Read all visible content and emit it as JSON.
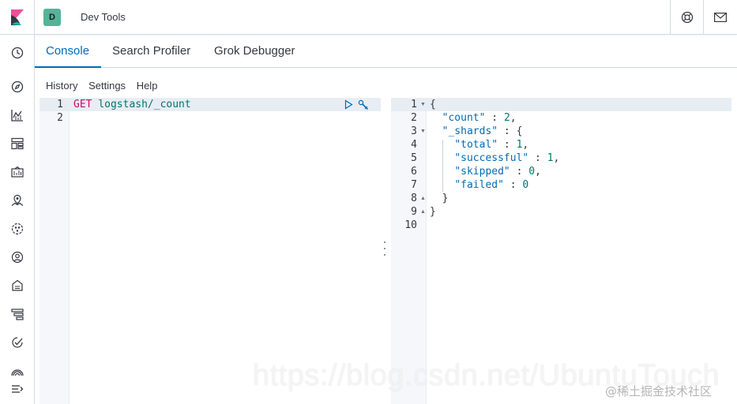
{
  "header": {
    "app_title": "Dev Tools",
    "space_initial": "D",
    "space_color": "#54b399",
    "right_icons": [
      "help-icon",
      "mail-icon"
    ]
  },
  "sidenav": {
    "icons": [
      "clock-icon",
      "compass-icon",
      "visualize-icon",
      "dashboard-icon",
      "canvas-icon",
      "maps-icon",
      "ml-icon",
      "infrastructure-icon",
      "logs-icon",
      "apm-icon",
      "uptime-icon",
      "siem-icon",
      "dev-tools-icon",
      "collapse-icon"
    ]
  },
  "tabs": [
    {
      "label": "Console",
      "active": true
    },
    {
      "label": "Search Profiler",
      "active": false
    },
    {
      "label": "Grok Debugger",
      "active": false
    }
  ],
  "submenu": [
    "History",
    "Settings",
    "Help"
  ],
  "request_editor": {
    "line_numbers": [
      "1",
      "2"
    ],
    "method": "GET",
    "url": "logstash/_count"
  },
  "response_editor": {
    "line_numbers": [
      "1",
      "2",
      "3",
      "4",
      "5",
      "6",
      "7",
      "8",
      "9",
      "10"
    ],
    "lines": [
      [
        {
          "t": "{",
          "c": "punct"
        }
      ],
      [
        {
          "t": "  ",
          "c": "punct"
        },
        {
          "t": "\"count\"",
          "c": "key"
        },
        {
          "t": " : ",
          "c": "punct"
        },
        {
          "t": "2",
          "c": "num"
        },
        {
          "t": ",",
          "c": "punct"
        }
      ],
      [
        {
          "t": "  ",
          "c": "punct"
        },
        {
          "t": "\"_shards\"",
          "c": "key"
        },
        {
          "t": " : {",
          "c": "punct"
        }
      ],
      [
        {
          "t": "    ",
          "c": "punct"
        },
        {
          "t": "\"total\"",
          "c": "key"
        },
        {
          "t": " : ",
          "c": "punct"
        },
        {
          "t": "1",
          "c": "num"
        },
        {
          "t": ",",
          "c": "punct"
        }
      ],
      [
        {
          "t": "    ",
          "c": "punct"
        },
        {
          "t": "\"successful\"",
          "c": "key"
        },
        {
          "t": " : ",
          "c": "punct"
        },
        {
          "t": "1",
          "c": "num"
        },
        {
          "t": ",",
          "c": "punct"
        }
      ],
      [
        {
          "t": "    ",
          "c": "punct"
        },
        {
          "t": "\"skipped\"",
          "c": "key"
        },
        {
          "t": " : ",
          "c": "punct"
        },
        {
          "t": "0",
          "c": "num"
        },
        {
          "t": ",",
          "c": "punct"
        }
      ],
      [
        {
          "t": "    ",
          "c": "punct"
        },
        {
          "t": "\"failed\"",
          "c": "key"
        },
        {
          "t": " : ",
          "c": "punct"
        },
        {
          "t": "0",
          "c": "num"
        }
      ],
      [
        {
          "t": "  }",
          "c": "punct"
        }
      ],
      [
        {
          "t": "}",
          "c": "punct"
        }
      ],
      [
        {
          "t": "",
          "c": "punct"
        }
      ]
    ]
  },
  "watermark": "https://blog.csdn.net/UbuntuTouch",
  "watermark_site": "@稀土掘金技术社区",
  "colors": {
    "accent": "#006bb4",
    "method": "#c80a68",
    "key": "#006bb4",
    "value": "#00756c"
  }
}
